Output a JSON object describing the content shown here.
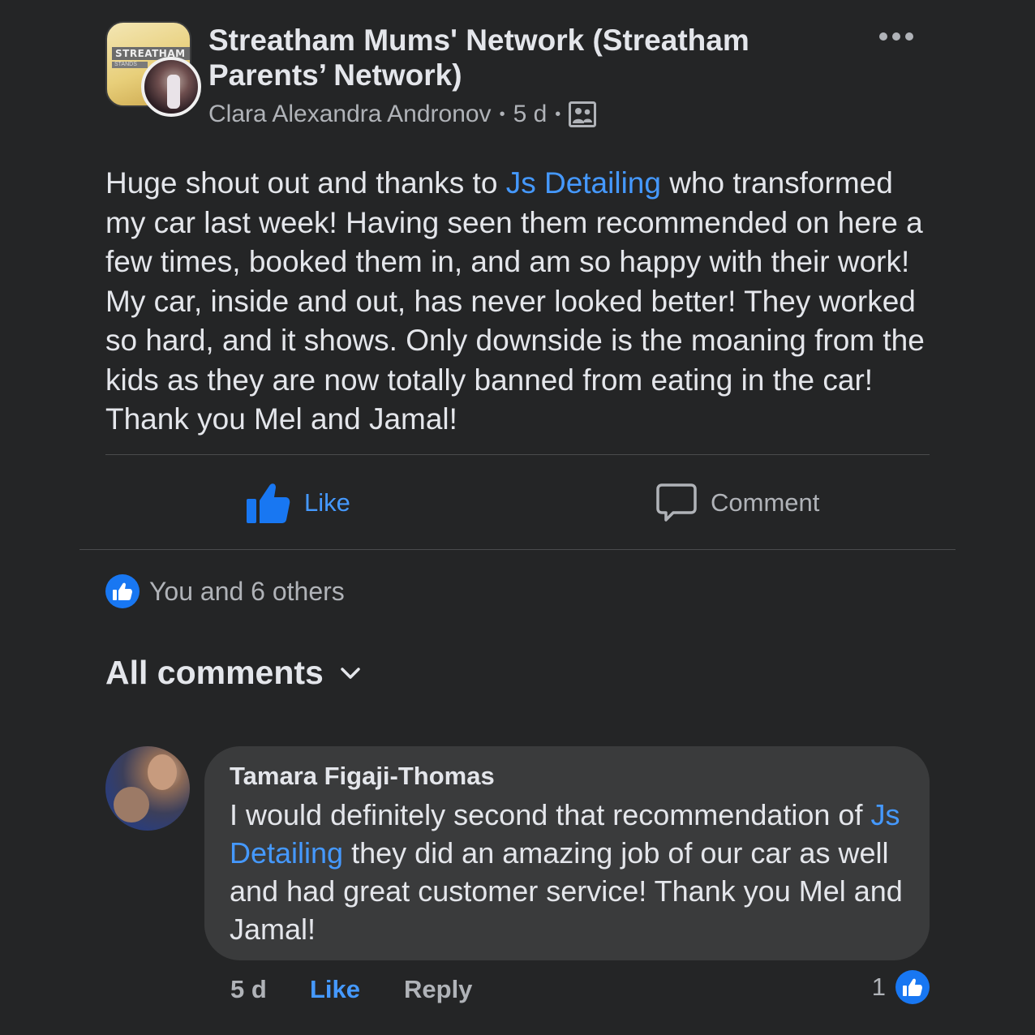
{
  "post": {
    "group_name": "Streatham Mums' Network (Streatham Parents’ Network)",
    "group_avatar_text": "STREATHAM",
    "group_avatar_subtext": "STANDS",
    "author": "Clara Alexandra Andronov",
    "time": "5 d",
    "separator": "•",
    "body_before_link": "Huge shout out and thanks to ",
    "body_link": "Js Detailing",
    "body_after_link": " who transformed my car last week! Having seen them recommended on here a few times, booked them in, and am so happy with their work! My car, inside and out, has never looked better! They worked so hard, and it shows. Only downside is the moaning from the kids as they are now totally banned from eating in the car! Thank you Mel and Jamal!"
  },
  "actions": {
    "like_label": "Like",
    "comment_label": "Comment"
  },
  "reactions": {
    "summary": "You and 6 others"
  },
  "comments_filter": {
    "label": "All comments"
  },
  "comment": {
    "author": "Tamara Figaji-Thomas",
    "text_before_link": "I would definitely second that recommendation of ",
    "text_link": "Js Detailing",
    "text_after_link": " they did an amazing job of our car as well and had great customer service! Thank you Mel and Jamal!",
    "time": "5 d",
    "like_label": "Like",
    "reply_label": "Reply",
    "reaction_count": "1"
  },
  "colors": {
    "background": "#242526",
    "bubble": "#3a3b3c",
    "accent_blue": "#4599ff",
    "reaction_blue": "#1877f2",
    "secondary_text": "#b0b3b8"
  },
  "icons": {
    "more": "more-horizontal-icon",
    "members": "group-members-icon",
    "like": "thumbs-up-icon",
    "comment": "speech-bubble-icon",
    "filter": "chevron-down-icon"
  }
}
